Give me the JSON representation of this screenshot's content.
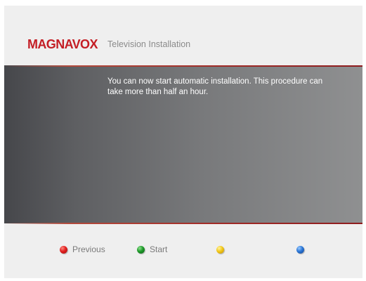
{
  "header": {
    "brand": "MAGNAVOX",
    "title": "Television Installation"
  },
  "main": {
    "message": "You can now start automatic installation. This procedure can take more than half an hour."
  },
  "footer": {
    "keys": [
      {
        "color": "red",
        "icon": "red-button-icon",
        "label": "Previous"
      },
      {
        "color": "green",
        "icon": "green-button-icon",
        "label": "Start"
      },
      {
        "color": "yellow",
        "icon": "yellow-button-icon",
        "label": ""
      },
      {
        "color": "blue",
        "icon": "blue-button-icon",
        "label": ""
      }
    ]
  },
  "colors": {
    "brand": "#c41e25",
    "panel_dark": "#46474b",
    "panel_light": "#8f9091",
    "accent_rule": "#a02a26"
  }
}
